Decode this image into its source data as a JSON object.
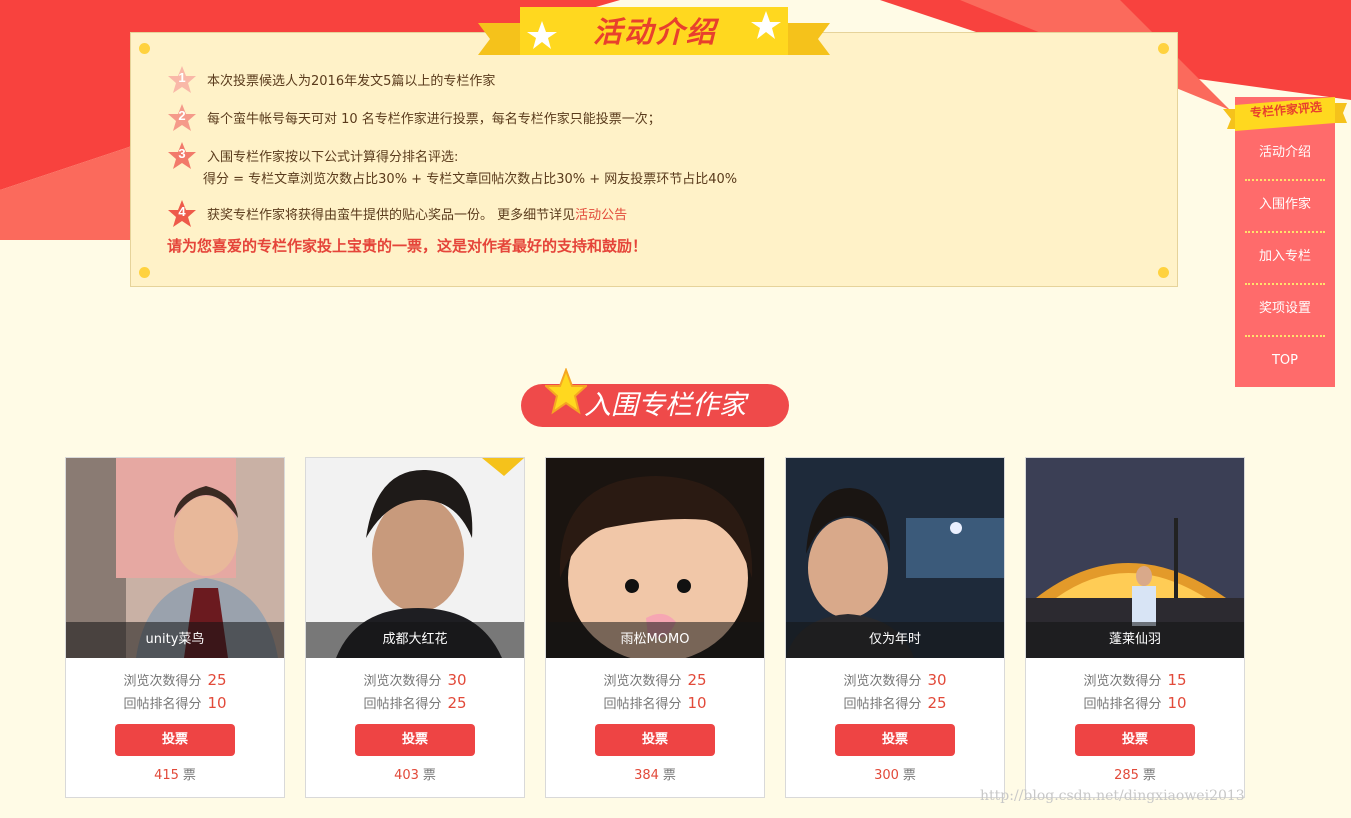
{
  "intro": {
    "banner_title": "活动介绍",
    "rules": [
      {
        "num": "1",
        "text": "本次投票候选人为2016年发文5篇以上的专栏作家"
      },
      {
        "num": "2",
        "text": "每个蛮牛帐号每天可对 10 名专栏作家进行投票，每名专栏作家只能投票一次；"
      },
      {
        "num": "3",
        "text": "入围专栏作家按以下公式计算得分排名评选:"
      },
      {
        "num": "4",
        "text": "获奖专栏作家将获得由蛮牛提供的贴心奖品一份。 更多细节详见",
        "link": "活动公告"
      }
    ],
    "formula": "得分 = 专栏文章浏览次数占比30% + 专栏文章回帖次数占比30% + 网友投票环节占比40%",
    "slogan": "请为您喜爱的专栏作家投上宝贵的一票，这是对作者最好的支持和鼓励！"
  },
  "sidenav": {
    "title": "专栏作家评选",
    "items": [
      "活动介绍",
      "入围作家",
      "加入专栏",
      "奖项设置",
      "TOP"
    ]
  },
  "section_title": "入围专栏作家",
  "cards": [
    {
      "name": "unity菜鸟",
      "views_label": "浏览次数得分",
      "views": "25",
      "replies_label": "回帖排名得分",
      "replies": "10",
      "button": "投票",
      "votes": "415",
      "votes_unit": "票"
    },
    {
      "name": "成都大红花",
      "views_label": "浏览次数得分",
      "views": "30",
      "replies_label": "回帖排名得分",
      "replies": "25",
      "button": "投票",
      "votes": "403",
      "votes_unit": "票"
    },
    {
      "name": "雨松MOMO",
      "views_label": "浏览次数得分",
      "views": "25",
      "replies_label": "回帖排名得分",
      "replies": "10",
      "button": "投票",
      "votes": "384",
      "votes_unit": "票"
    },
    {
      "name": "仅为年时",
      "views_label": "浏览次数得分",
      "views": "30",
      "replies_label": "回帖排名得分",
      "replies": "25",
      "button": "投票",
      "votes": "300",
      "votes_unit": "票"
    },
    {
      "name": "蓬莱仙羽",
      "views_label": "浏览次数得分",
      "views": "15",
      "replies_label": "回帖排名得分",
      "replies": "10",
      "button": "投票",
      "votes": "285",
      "votes_unit": "票"
    }
  ],
  "watermark": "http://blog.csdn.net/dingxiaowei2013",
  "colors": {
    "accent": "#ee4444",
    "panel": "#fff2c8",
    "page": "#fffbe6",
    "sidenav": "#ff6b6b"
  }
}
